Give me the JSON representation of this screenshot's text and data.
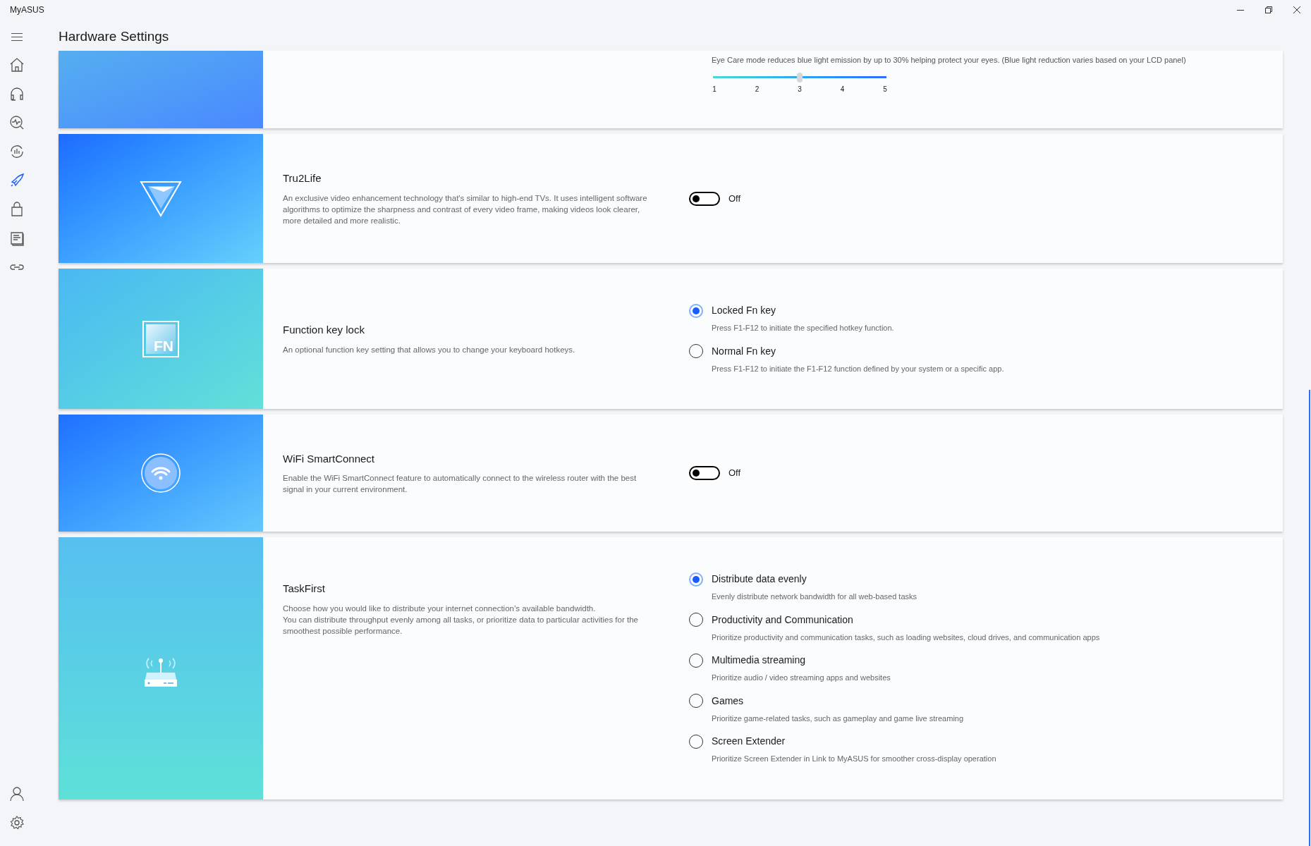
{
  "window": {
    "title": "MyASUS"
  },
  "sidebar": {
    "items": [
      {
        "selected": false
      },
      {
        "selected": false
      },
      {
        "selected": false
      },
      {
        "selected": false
      },
      {
        "selected": true
      },
      {
        "selected": false
      },
      {
        "selected": false
      },
      {
        "selected": false
      }
    ],
    "bottom_items": [
      {
        "selected": false
      },
      {
        "selected": false
      }
    ]
  },
  "page_title": "Hardware Settings",
  "cards": [
    {
      "kind": "slider",
      "description": "Eye Care mode reduces blue light emission by up to 30% helping protect your eyes. (Blue light reduction varies based on your LCD panel)",
      "slider": {
        "level": 0.5,
        "ticks": [
          "1",
          "2",
          "3",
          "4",
          "5"
        ]
      }
    },
    {
      "kind": "toggle",
      "title": "Tru2Life",
      "description": "An exclusive video enhancement technology that's similar to high-end TVs. It uses intelligent software algorithms to optimize the sharpness and contrast of every video frame, making videos look clearer, more detailed and more realistic.",
      "toggle": {
        "on": false,
        "label": "Off"
      }
    },
    {
      "kind": "radio",
      "title": "Function key lock",
      "icon_text": "FN",
      "description": "An optional function key setting that allows you to change your keyboard hotkeys.",
      "options": [
        {
          "label": "Locked Fn key",
          "hint": "Press F1-F12 to initiate the specified hotkey function.",
          "selected": true
        },
        {
          "label": "Normal Fn key",
          "hint": "Press F1-F12 to initiate the F1-F12 function defined by your system or a specific app.",
          "selected": false
        }
      ]
    },
    {
      "kind": "toggle",
      "title": "WiFi SmartConnect",
      "description": "Enable the WiFi SmartConnect feature to automatically connect to the wireless router with the best signal in your current environment.",
      "toggle": {
        "on": false,
        "label": "Off"
      }
    },
    {
      "kind": "radio",
      "title": "TaskFirst",
      "description": "Choose how you would like to distribute your internet connection’s available bandwidth.\nYou can distribute throughput evenly among all tasks, or prioritize data to particular activities for the smoothest possible performance.",
      "options": [
        {
          "label": "Distribute data evenly",
          "hint": "Evenly distribute network bandwidth for all web-based tasks",
          "selected": true
        },
        {
          "label": "Productivity and Communication",
          "hint": "Prioritize productivity and communication tasks, such as loading websites, cloud drives, and communication apps",
          "selected": false
        },
        {
          "label": "Multimedia streaming",
          "hint": "Prioritize audio / video streaming apps and websites",
          "selected": false
        },
        {
          "label": "Games",
          "hint": "Prioritize game-related tasks, such as gameplay and game live streaming",
          "selected": false
        },
        {
          "label": "Screen Extender",
          "hint": "Prioritize Screen Extender in Link to MyASUS for smoother cross-display operation",
          "selected": false
        }
      ]
    }
  ]
}
